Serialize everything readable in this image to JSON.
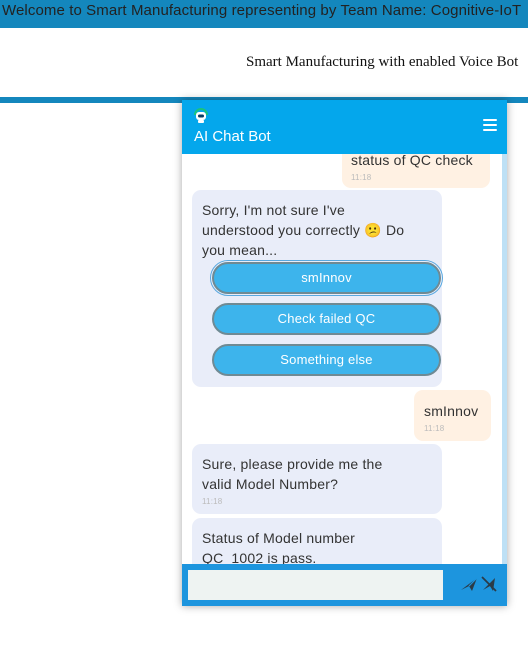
{
  "banner": {
    "text": "Welcome to Smart Manufacturing representing by Team Name: Cognitive-IoT"
  },
  "page": {
    "subtitle": "Smart Manufacturing with enabled Voice Bot"
  },
  "chat": {
    "title": "AI Chat Bot",
    "messages": {
      "m0": {
        "text": "status of QC check",
        "time": "11:18"
      },
      "m1": {
        "line1": "Sorry, I'm not sure I've",
        "line2": "understood you correctly",
        "emoji": "😕",
        "line2b": "Do",
        "line3": "you mean..."
      },
      "m2": {
        "text": "smInnov",
        "time": "11:18"
      },
      "m3": {
        "line1": "Sure, please provide me the",
        "line2": "valid Model Number?",
        "time": "11:18"
      },
      "m4": {
        "line1": "Status of Model number",
        "line2": "QC_1002 is pass."
      }
    },
    "quick_replies": [
      "smInnov",
      "Check failed QC",
      "Something else"
    ],
    "input": {
      "value": "",
      "placeholder": ""
    }
  },
  "colors": {
    "banner": "#1487bd",
    "header": "#04a7ec",
    "quick_reply": "#3db4ec",
    "footer": "#1d95de",
    "user_bubble": "#fff1e3",
    "bot_bubble": "#e9edf9"
  },
  "icons": {
    "bot": "robot-icon",
    "menu": "hamburger-menu-icon",
    "send": "send-icon",
    "mic": "mic-off-icon"
  }
}
